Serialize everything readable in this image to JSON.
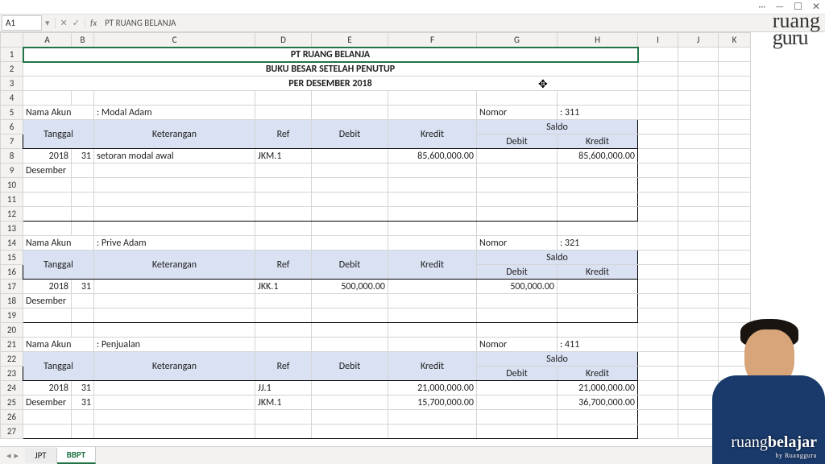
{
  "window": {
    "ellipsis": "···",
    "min": "—",
    "max": "☐",
    "close": "✕"
  },
  "ref": {
    "cell": "A1",
    "icons": {
      "down": "▾",
      "cancel": "✕",
      "confirm": "✓"
    },
    "fx": "fx",
    "formula": "PT RUANG BELANJA"
  },
  "cols": [
    "",
    "A",
    "B",
    "C",
    "D",
    "E",
    "F",
    "G",
    "H",
    "I",
    "J",
    "K"
  ],
  "title1": "PT RUANG BELANJA",
  "title2": "BUKU BESAR SETELAH PENUTUP",
  "title3": "PER DESEMBER 2018",
  "labels": {
    "nama_akun": "Nama Akun",
    "nomor": "Nomor",
    "tanggal": "Tanggal",
    "keterangan": "Keterangan",
    "ref": "Ref",
    "debit": "Debit",
    "kredit": "Kredit",
    "saldo": "Saldo",
    "desember": "Desember"
  },
  "ledgers": [
    {
      "name": ": Modal Adam",
      "nomor": ": 311",
      "rows": [
        {
          "y": "2018",
          "d": "31",
          "ket": "setoran modal awal",
          "ref": "JKM.1",
          "debit": "",
          "kredit": "85,600,000.00",
          "sdebit": "",
          "skredit": "85,600,000.00"
        }
      ]
    },
    {
      "name": ": Prive Adam",
      "nomor": ": 321",
      "rows": [
        {
          "y": "2018",
          "d": "31",
          "ket": "",
          "ref": "JKK.1",
          "debit": "500,000.00",
          "kredit": "",
          "sdebit": "500,000.00",
          "skredit": ""
        }
      ]
    },
    {
      "name": ": Penjualan",
      "nomor": ": 411",
      "rows": [
        {
          "y": "2018",
          "d": "31",
          "ket": "",
          "ref": "JJ.1",
          "debit": "",
          "kredit": "21,000,000.00",
          "sdebit": "",
          "skredit": "21,000,000.00"
        },
        {
          "y": "Desember",
          "d": "31",
          "ket": "",
          "ref": "JKM.1",
          "debit": "",
          "kredit": "15,700,000.00",
          "sdebit": "",
          "skredit": "36,700,000.00"
        }
      ]
    }
  ],
  "tabs": {
    "nav": [
      "◂",
      "▸"
    ],
    "items": [
      "JPT",
      "BBPT"
    ],
    "active": 1
  },
  "brand_top": {
    "l1": "ruang",
    "l2": "guru"
  },
  "brand_bottom": {
    "main1": "ruang",
    "main2": "belajar",
    "sub": "by Ruangguru"
  }
}
